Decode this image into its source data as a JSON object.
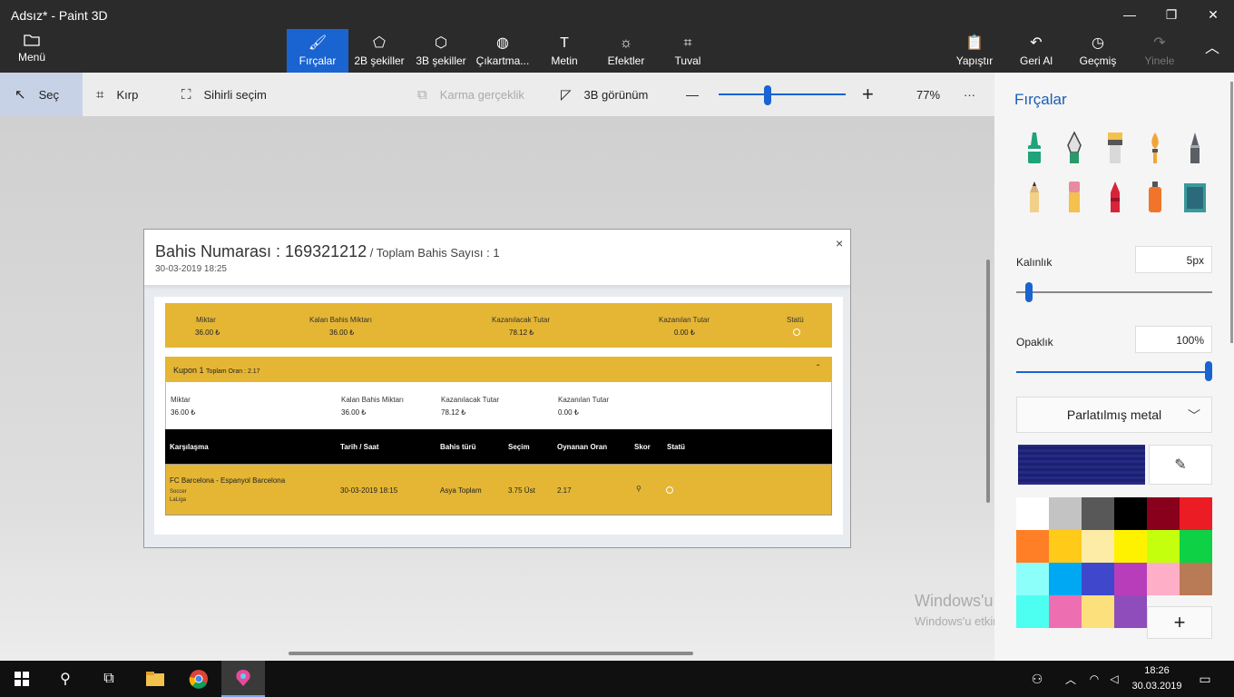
{
  "window": {
    "title": "Adsız* - Paint 3D",
    "minimize": "—",
    "maximize": "❐",
    "close": "✕"
  },
  "ribbon": {
    "menu": {
      "label": "Menü",
      "icon": "folder-icon"
    },
    "tools": [
      {
        "label": "Fırçalar",
        "icon": "brush-icon",
        "active": true
      },
      {
        "label": "2B şekiller",
        "icon": "2d-shapes-icon"
      },
      {
        "label": "3B şekiller",
        "icon": "3d-cube-icon"
      },
      {
        "label": "Çıkartma...",
        "icon": "sticker-icon"
      },
      {
        "label": "Metin",
        "icon": "text-icon"
      },
      {
        "label": "Efektler",
        "icon": "sun-icon"
      },
      {
        "label": "Tuval",
        "icon": "canvas-icon"
      }
    ],
    "right": [
      {
        "label": "Yapıştır",
        "icon": "paste-icon"
      },
      {
        "label": "Geri Al",
        "icon": "undo-icon"
      },
      {
        "label": "Geçmiş",
        "icon": "history-icon"
      },
      {
        "label": "Yinele",
        "icon": "redo-icon",
        "disabled": true
      }
    ],
    "collapse_icon": "chevron-up-icon"
  },
  "commandbar": {
    "select": "Seç",
    "crop": "Kırp",
    "magic_select": "Sihirli seçim",
    "mixed_reality": "Karma gerçeklik",
    "view_3d": "3B görünüm",
    "zoom_minus": "—",
    "zoom_plus": "+",
    "zoom_level": "77%",
    "zoom_value": 0.38,
    "more": "···"
  },
  "canvas_image": {
    "title_main": "Bahis Numarası : 169321212",
    "title_sub": " / Toplam Bahis Sayısı : 1",
    "date": "30-03-2019 18:25",
    "close": "×",
    "summary": {
      "labels": [
        "Miktar",
        "Kalan Bahis Miktarı",
        "Kazanılacak Tutar",
        "Kazanılan Tutar",
        "Statü"
      ],
      "values": [
        "36.00 ₺",
        "36.00 ₺",
        "78.12 ₺",
        "0.00 ₺"
      ]
    },
    "coupon": {
      "title": "Kupon 1",
      "sub": "Toplam Oran : 2.17",
      "chevron": "ˆ"
    },
    "coupon_summary": {
      "labels": [
        "Miktar",
        "Kalan Bahis Miktarı",
        "Kazanılacak Tutar",
        "Kazanılan Tutar"
      ],
      "values": [
        "36.00 ₺",
        "36.00 ₺",
        "78.12 ₺",
        "0.00 ₺"
      ]
    },
    "table": {
      "headers": [
        "Karşılaşma",
        "Tarih / Saat",
        "Bahis türü",
        "Seçim",
        "Oynanan Oran",
        "Skor",
        "Statü"
      ],
      "row": {
        "match": "FC Barcelona - Espanyol Barcelona",
        "sport": "Soccer",
        "league": "LaLiga",
        "datetime": "30-03-2019 18:15",
        "bet_type": "Asya Toplam",
        "selection": "3.75 Üst",
        "odds": "2.17"
      }
    }
  },
  "panel": {
    "title": "Fırçalar",
    "thickness_label": "Kalınlık",
    "thickness_value": "5px",
    "thickness_level": 0.05,
    "opacity_label": "Opaklık",
    "opacity_value": "100%",
    "opacity_level": 1.0,
    "texture": "Parlatılmış metal",
    "brushes": [
      {
        "name": "marker",
        "color": "#1fa37a"
      },
      {
        "name": "calligraphy-pen",
        "color": "#2a9a6a"
      },
      {
        "name": "oil-brush",
        "color": "#d9d9d9"
      },
      {
        "name": "watercolor",
        "color": "#f2a53a"
      },
      {
        "name": "pixel-pen",
        "color": "#5a5f66"
      },
      {
        "name": "pencil",
        "color": "#d8b07a"
      },
      {
        "name": "eraser",
        "color": "#e88aa0"
      },
      {
        "name": "crayon",
        "color": "#d8243a"
      },
      {
        "name": "spray-can",
        "color": "#f0742a"
      },
      {
        "name": "fill-bucket",
        "color": "#3a9a9a"
      }
    ],
    "current_color": "#262a86",
    "palette": [
      "#ffffff",
      "#c3c3c3",
      "#585858",
      "#000000",
      "#88001b",
      "#ec1c24",
      "#ff7f27",
      "#ffca18",
      "#fdeca6",
      "#fff200",
      "#c4ff0e",
      "#0ed145",
      "#8cfffb",
      "#00a8f3",
      "#3f48cc",
      "#b83dba",
      "#ffaec8",
      "#b97a56",
      "#4dfff0",
      "#ee6fb1",
      "#fbe07b",
      "#8e4dbb"
    ],
    "add_color": "+"
  },
  "watermark": {
    "line1": "Windows'u Etkinleştir",
    "line2": "Windows'u etkinleştirmek için Ayarlar'a gidin."
  },
  "taskbar": {
    "time": "18:26",
    "date": "30.03.2019"
  }
}
